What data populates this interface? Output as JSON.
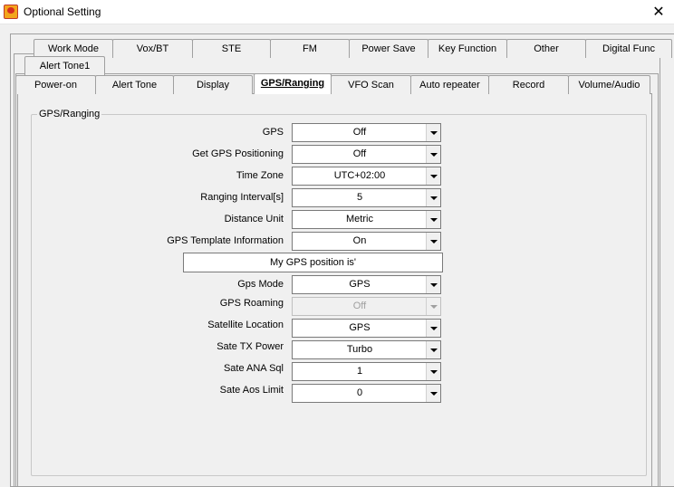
{
  "window": {
    "title": "Optional Setting"
  },
  "tabs_row1": [
    {
      "label": "Work Mode"
    },
    {
      "label": "Vox/BT"
    },
    {
      "label": "STE"
    },
    {
      "label": "FM"
    },
    {
      "label": "Power Save"
    },
    {
      "label": "Key Function"
    },
    {
      "label": "Other"
    },
    {
      "label": "Digital Func"
    }
  ],
  "tabs_row2": [
    {
      "label": "Alert Tone1"
    }
  ],
  "tabs_row3": [
    {
      "label": "Power-on"
    },
    {
      "label": "Alert Tone"
    },
    {
      "label": "Display"
    },
    {
      "label": "GPS/Ranging"
    },
    {
      "label": "VFO Scan"
    },
    {
      "label": "Auto repeater"
    },
    {
      "label": "Record"
    },
    {
      "label": "Volume/Audio"
    }
  ],
  "active_tab": "GPS/Ranging",
  "group": {
    "title": "GPS/Ranging"
  },
  "fields": [
    {
      "label": "GPS",
      "value": "Off"
    },
    {
      "label": "Get GPS Positioning",
      "value": "Off"
    },
    {
      "label": "Time Zone",
      "value": "UTC+02:00"
    },
    {
      "label": "Ranging Interval[s]",
      "value": "5"
    },
    {
      "label": "Distance Unit",
      "value": "Metric"
    },
    {
      "label": "GPS Template Information",
      "value": "On"
    }
  ],
  "template_text": "My GPS position is'",
  "fields2": [
    {
      "label": "Gps Mode",
      "value": "GPS"
    },
    {
      "label": "GPS Roaming",
      "value": "Off",
      "disabled": true
    },
    {
      "label": "Satellite Location",
      "value": "GPS"
    },
    {
      "label": "Sate TX Power",
      "value": "Turbo"
    },
    {
      "label": "Sate ANA Sql",
      "value": "1"
    },
    {
      "label": "Sate Aos Limit",
      "value": "0"
    }
  ]
}
